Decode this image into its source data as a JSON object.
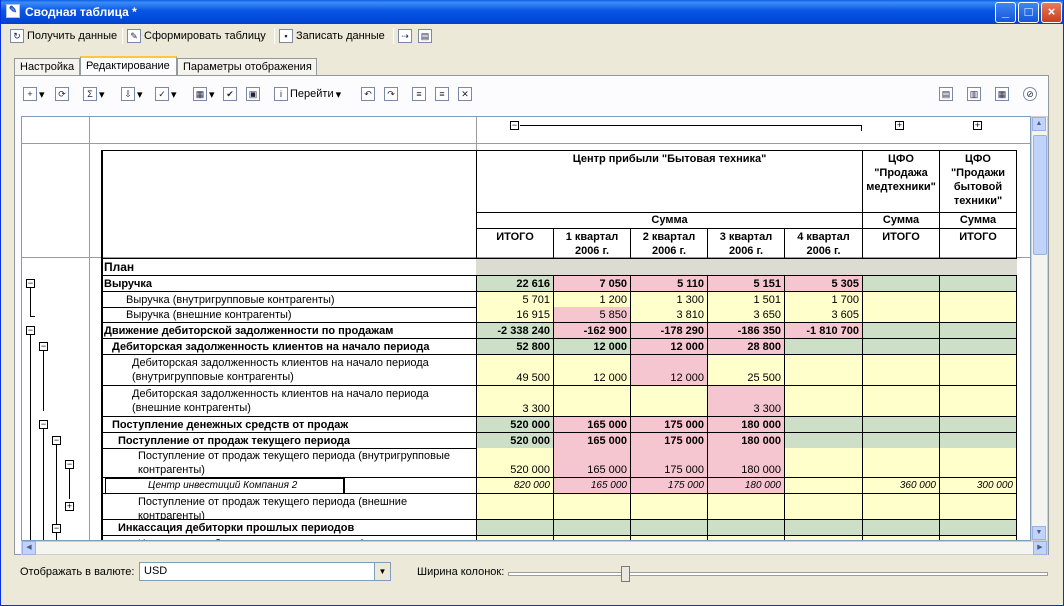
{
  "window": {
    "title": "Сводная таблица *"
  },
  "toolbar": {
    "get_data": "Получить данные",
    "build_table": "Сформировать таблицу",
    "write_data": "Записать данные"
  },
  "tabs": [
    "Настройка",
    "Редактирование",
    "Параметры отображения"
  ],
  "edit_toolbar": {
    "goto": "Перейти"
  },
  "headers": {
    "center": "Центр прибыли \"Бытовая техника\"",
    "cfo1": "ЦФО \"Продажа медтехники\"",
    "cfo2": "ЦФО \"Продажи бытовой техники\"",
    "summa": "Сумма",
    "itogo": "ИТОГО",
    "q1": "1 квартал 2006 г.",
    "q2": "2 квартал 2006 г.",
    "q3": "3 квартал 2006 г.",
    "q4": "4 квартал 2006 г."
  },
  "plan_label": "План",
  "rows": [
    {
      "label": "Выручка",
      "values": [
        "22 616",
        "7 050",
        "5 110",
        "5 151",
        "5 305",
        "",
        ""
      ]
    },
    {
      "label": "Выручка (внутригрупповые контрагенты)",
      "values": [
        "5 701",
        "1 200",
        "1 300",
        "1 501",
        "1 700",
        "",
        ""
      ]
    },
    {
      "label": "Выручка (внешние контрагенты)",
      "values": [
        "16 915",
        "5 850",
        "3 810",
        "3 650",
        "3 605",
        "",
        ""
      ]
    },
    {
      "label": "Движение дебиторской задолженности по продажам",
      "values": [
        "-2 338 240",
        "-162 900",
        "-178 290",
        "-186 350",
        "-1 810 700",
        "",
        ""
      ]
    },
    {
      "label": "Дебиторская задолженность клиентов на начало периода",
      "values": [
        "52 800",
        "12 000",
        "12 000",
        "28 800",
        "",
        "",
        ""
      ]
    },
    {
      "label": "Дебиторская задолженность клиентов на начало периода (внутригрупповые контрагенты)",
      "values": [
        "49 500",
        "12 000",
        "12 000",
        "25 500",
        "",
        "",
        ""
      ]
    },
    {
      "label": "Дебиторская задолженность клиентов на начало периода (внешние контрагенты)",
      "values": [
        "3 300",
        "",
        "",
        "3 300",
        "",
        "",
        ""
      ]
    },
    {
      "label": "Поступление денежных средств от продаж",
      "values": [
        "520 000",
        "165 000",
        "175 000",
        "180 000",
        "",
        "",
        ""
      ]
    },
    {
      "label": "Поступление от продаж текущего периода",
      "values": [
        "520 000",
        "165 000",
        "175 000",
        "180 000",
        "",
        "",
        ""
      ]
    },
    {
      "label": "Поступление от продаж текущего периода (внутригрупповые контрагенты)",
      "values": [
        "520 000",
        "165 000",
        "175 000",
        "180 000",
        "",
        "",
        ""
      ]
    },
    {
      "label": "Центр инвестиций Компания 2",
      "values": [
        "820 000",
        "165 000",
        "175 000",
        "180 000",
        "",
        "360 000",
        "300 000"
      ]
    },
    {
      "label": "Поступление от продаж текущего периода (внешние контрагенты)",
      "values": [
        "",
        "",
        "",
        "",
        "",
        "",
        ""
      ]
    },
    {
      "label": "Инкассация дебиторки прошлых периодов",
      "values": [
        "",
        "",
        "",
        "",
        "",
        "",
        ""
      ]
    },
    {
      "label": "Инкассация дебиторки прошлых периодов (внутригрупповые",
      "values": [
        "",
        "",
        "",
        "",
        "",
        "",
        ""
      ]
    }
  ],
  "footer": {
    "currency_label": "Отображать в валюте:",
    "currency_value": "USD",
    "width_label": "Ширина колонок:"
  }
}
